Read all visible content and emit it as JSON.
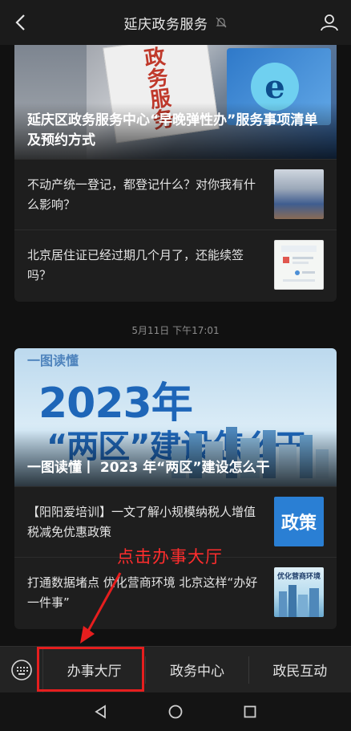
{
  "header": {
    "title": "延庆政务服务",
    "back_icon": "chevron-left-icon",
    "mute_icon": "bell-off-icon",
    "profile_icon": "user-icon"
  },
  "card1": {
    "hero_title": "延庆区政务服务中心“早晚弹性办”服务事项清单及预约方式",
    "hero_image_text": "政务服务",
    "items": [
      {
        "text": "不动产统一登记，都登记什么？对你我有什么影响？"
      },
      {
        "text": "北京居住证已经过期几个月了，还能续签吗？"
      }
    ]
  },
  "timestamp": "5月11日 下午17:01",
  "card2": {
    "hero_title": "一图读懂丨 2023 年“两区”建设怎么干",
    "poster": {
      "line1": "一图读懂",
      "year": "2023年",
      "sub": "“两区”建设怎么干"
    },
    "items": [
      {
        "text": "【阳阳爱培训】一文了解小规模纳税人增值税减免优惠政策",
        "thumb_text": "政策"
      },
      {
        "text": "打通数据堵点 优化营商环境 北京这样“办好一件事”",
        "thumb_text": "优化营商环境"
      }
    ]
  },
  "annotation": {
    "text": "点击办事大厅",
    "color": "#ff2d2d"
  },
  "menu": {
    "keyboard_icon": "keyboard-icon",
    "items": [
      {
        "label": "办事大厅"
      },
      {
        "label": "政务中心"
      },
      {
        "label": "政民互动"
      }
    ]
  },
  "system_nav": {
    "back": "triangle-back-icon",
    "home": "circle-home-icon",
    "recent": "square-recent-icon"
  }
}
